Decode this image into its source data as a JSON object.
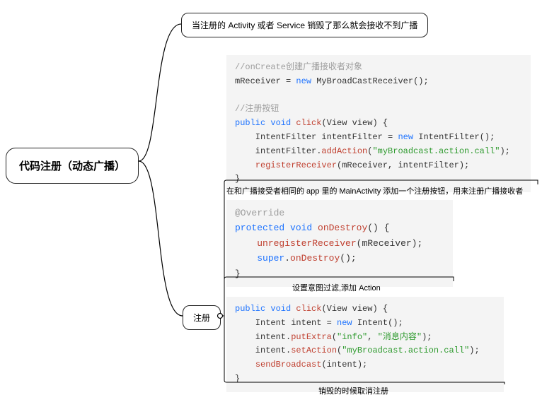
{
  "root": {
    "label": "代码注册（动态广播）"
  },
  "note_top": {
    "label": "当注册的 Activity 或者 Service 销毁了那么就会接收不到广播"
  },
  "register_node": {
    "label": "注册"
  },
  "code_block_a": {
    "lines": [
      {
        "segments": [
          {
            "text": "//onCreate创建广播接收者对象",
            "cls": "tok-comment"
          }
        ]
      },
      {
        "segments": [
          {
            "text": "mReceiver ",
            "cls": "tok-ident"
          },
          {
            "text": "= ",
            "cls": "tok-ident"
          },
          {
            "text": "new ",
            "cls": "tok-keyword"
          },
          {
            "text": "MyBroadCastReceiver",
            "cls": "tok-type"
          },
          {
            "text": "();",
            "cls": "tok-ident"
          }
        ]
      },
      {
        "segments": [
          {
            "text": "",
            "cls": "tok-ident"
          }
        ]
      },
      {
        "segments": [
          {
            "text": "//注册按钮",
            "cls": "tok-comment"
          }
        ]
      },
      {
        "segments": [
          {
            "text": "public void ",
            "cls": "tok-keyword"
          },
          {
            "text": "click",
            "cls": "tok-method"
          },
          {
            "text": "(View view) {",
            "cls": "tok-ident"
          }
        ]
      },
      {
        "segments": [
          {
            "text": "    IntentFilter intentFilter ",
            "cls": "tok-ident"
          },
          {
            "text": "= ",
            "cls": "tok-ident"
          },
          {
            "text": "new ",
            "cls": "tok-keyword"
          },
          {
            "text": "IntentFilter",
            "cls": "tok-type"
          },
          {
            "text": "();",
            "cls": "tok-ident"
          }
        ]
      },
      {
        "segments": [
          {
            "text": "    intentFilter.",
            "cls": "tok-ident"
          },
          {
            "text": "addAction",
            "cls": "tok-method"
          },
          {
            "text": "(",
            "cls": "tok-ident"
          },
          {
            "text": "\"myBroadcast.action.call\"",
            "cls": "tok-string"
          },
          {
            "text": ");",
            "cls": "tok-ident"
          }
        ]
      },
      {
        "segments": [
          {
            "text": "    ",
            "cls": "tok-ident"
          },
          {
            "text": "registerReceiver",
            "cls": "tok-method"
          },
          {
            "text": "(mReceiver, intentFilter);",
            "cls": "tok-ident"
          }
        ]
      },
      {
        "segments": [
          {
            "text": "}",
            "cls": "tok-ident"
          }
        ]
      }
    ]
  },
  "caption_a": {
    "text": "在和广播接受者相同的 app 里的 MainActivity 添加一个注册按钮，用来注册广播接收者"
  },
  "code_block_b": {
    "lines": [
      {
        "segments": [
          {
            "text": "@Override",
            "cls": "tok-annot"
          }
        ]
      },
      {
        "segments": [
          {
            "text": "protected void ",
            "cls": "tok-keyword"
          },
          {
            "text": "onDestroy",
            "cls": "tok-method"
          },
          {
            "text": "() {",
            "cls": "tok-ident"
          }
        ]
      },
      {
        "segments": [
          {
            "text": "    ",
            "cls": "tok-ident"
          },
          {
            "text": "unregisterReceiver",
            "cls": "tok-method"
          },
          {
            "text": "(mReceiver);",
            "cls": "tok-ident"
          }
        ]
      },
      {
        "segments": [
          {
            "text": "    ",
            "cls": "tok-ident"
          },
          {
            "text": "super",
            "cls": "tok-keyword"
          },
          {
            "text": ".",
            "cls": "tok-ident"
          },
          {
            "text": "onDestroy",
            "cls": "tok-method"
          },
          {
            "text": "();",
            "cls": "tok-ident"
          }
        ]
      },
      {
        "segments": [
          {
            "text": "}",
            "cls": "tok-ident"
          }
        ]
      }
    ]
  },
  "caption_b": {
    "text": "设置意图过滤,添加 Action"
  },
  "code_block_c": {
    "lines": [
      {
        "segments": [
          {
            "text": "public void ",
            "cls": "tok-keyword"
          },
          {
            "text": "click",
            "cls": "tok-method"
          },
          {
            "text": "(View view) {",
            "cls": "tok-ident"
          }
        ]
      },
      {
        "segments": [
          {
            "text": "    Intent intent ",
            "cls": "tok-ident"
          },
          {
            "text": "= ",
            "cls": "tok-ident"
          },
          {
            "text": "new ",
            "cls": "tok-keyword"
          },
          {
            "text": "Intent",
            "cls": "tok-type"
          },
          {
            "text": "();",
            "cls": "tok-ident"
          }
        ]
      },
      {
        "segments": [
          {
            "text": "    intent.",
            "cls": "tok-ident"
          },
          {
            "text": "putExtra",
            "cls": "tok-method"
          },
          {
            "text": "(",
            "cls": "tok-ident"
          },
          {
            "text": "\"info\"",
            "cls": "tok-string"
          },
          {
            "text": ", ",
            "cls": "tok-ident"
          },
          {
            "text": "\"消息内容\"",
            "cls": "tok-string"
          },
          {
            "text": ");",
            "cls": "tok-ident"
          }
        ]
      },
      {
        "segments": [
          {
            "text": "    intent.",
            "cls": "tok-ident"
          },
          {
            "text": "setAction",
            "cls": "tok-method"
          },
          {
            "text": "(",
            "cls": "tok-ident"
          },
          {
            "text": "\"myBroadcast.action.call\"",
            "cls": "tok-string"
          },
          {
            "text": ");",
            "cls": "tok-ident"
          }
        ]
      },
      {
        "segments": [
          {
            "text": "    ",
            "cls": "tok-ident"
          },
          {
            "text": "sendBroadcast",
            "cls": "tok-method"
          },
          {
            "text": "(intent);",
            "cls": "tok-ident"
          }
        ]
      },
      {
        "segments": [
          {
            "text": "}",
            "cls": "tok-ident"
          }
        ]
      }
    ]
  },
  "caption_c": {
    "text": "销毁的时候取消注册"
  }
}
